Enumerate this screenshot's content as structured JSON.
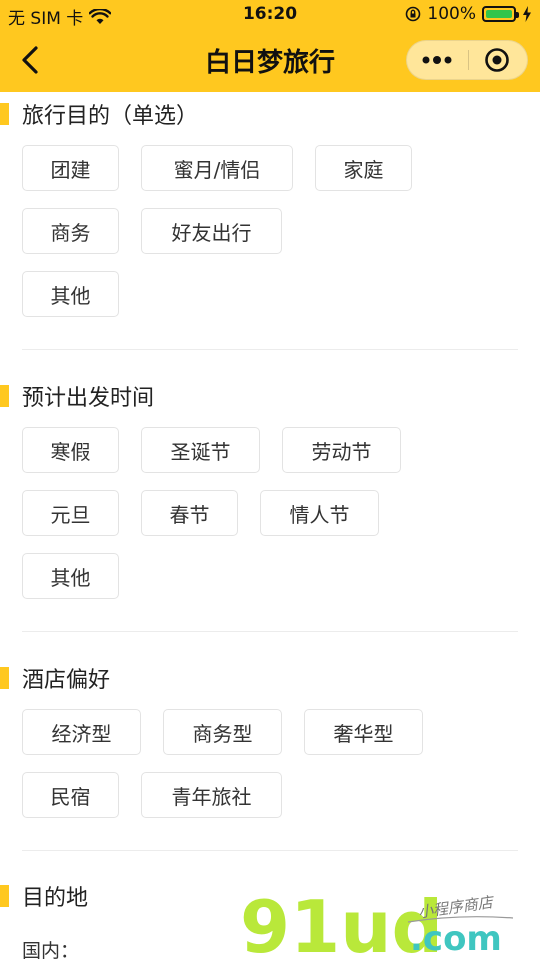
{
  "status": {
    "carrier": "无 SIM 卡",
    "time": "16:20",
    "battery": "100%"
  },
  "nav": {
    "title": "白日梦旅行"
  },
  "sections": {
    "purpose": {
      "title": "旅行目的（单选）",
      "options": [
        "团建",
        "蜜月/情侣",
        "家庭",
        "商务",
        "好友出行",
        "其他"
      ]
    },
    "time": {
      "title": "预计出发时间",
      "options": [
        "寒假",
        "圣诞节",
        "劳动节",
        "元旦",
        "春节",
        "情人节",
        "其他"
      ]
    },
    "hotel": {
      "title": "酒店偏好",
      "options": [
        "经济型",
        "商务型",
        "奢华型",
        "民宿",
        "青年旅社"
      ]
    },
    "destination": {
      "title": "目的地",
      "domestic_label": "国内："
    }
  },
  "watermark": {
    "brand": "91ud",
    "domain": ".com",
    "slogan": "小程序商店"
  },
  "colors": {
    "accent": "#FFC81F",
    "battery": "#31C54B",
    "watermark_green": "#B9E83A",
    "watermark_teal": "#3FC6C0"
  }
}
